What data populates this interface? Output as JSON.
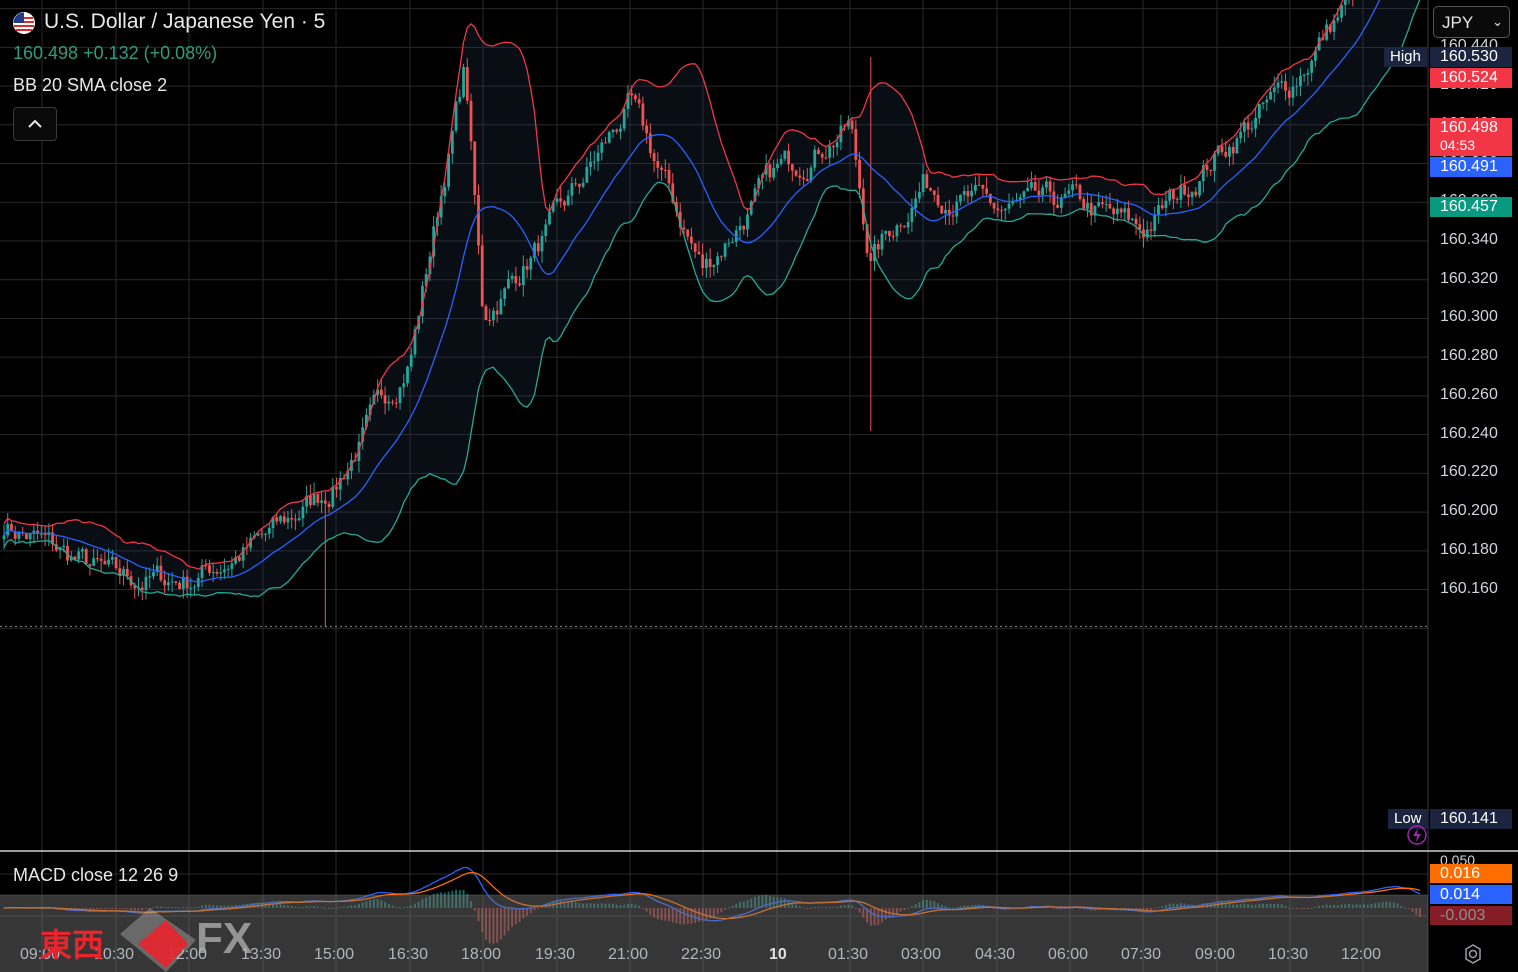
{
  "header": {
    "symbol_title": "U.S. Dollar / Japanese Yen · 5",
    "price_change": "160.498  +0.132 (+0.08%)",
    "indicator_label": "BB 20 SMA close 2",
    "currency": "JPY"
  },
  "macd": {
    "label": "MACD close 12 26 9"
  },
  "price_axis": {
    "labels": [
      "160.440",
      "160.420",
      "160.400",
      "160.380",
      "160.360",
      "160.340",
      "160.320",
      "160.300",
      "160.280",
      "160.260",
      "160.240",
      "160.220",
      "160.200",
      "160.180",
      "160.160"
    ],
    "range": [
      160.13,
      160.54
    ]
  },
  "tags": {
    "high_label": "High",
    "high_value": "160.530",
    "bb_upper": "160.524",
    "last_price": "160.498",
    "countdown": "04:53",
    "bb_basis": "160.491",
    "bb_lower": "160.457",
    "low_label": "Low",
    "low_value": "160.141",
    "macd_top": "0.050",
    "macd_signal": "0.016",
    "macd_line": "0.014",
    "macd_hist": "-0.003"
  },
  "time_axis": [
    "09:00",
    "10:30",
    "12:00",
    "13:30",
    "15:00",
    "16:30",
    "18:00",
    "19:30",
    "21:00",
    "22:30",
    "10",
    "01:30",
    "03:00",
    "04:30",
    "06:00",
    "07:30",
    "09:00",
    "10:30",
    "12:00"
  ],
  "colors": {
    "up": "#26a69a",
    "down": "#ef5350",
    "bb_upper": "#f23645",
    "bb_basis": "#2962ff",
    "bb_lower": "#22ab94",
    "macd": "#2962ff",
    "signal": "#ff6d00"
  },
  "watermark": {
    "text": "東西",
    "fx": "FX"
  },
  "chart_data": {
    "type": "candlestick",
    "x_range": [
      "09:00",
      "12:55"
    ],
    "y_range": [
      160.13,
      160.54
    ],
    "anchors": [
      {
        "time": "09:00",
        "price": 160.195
      },
      {
        "time": "10:30",
        "price": 160.165
      },
      {
        "time": "12:00",
        "price": 160.165
      },
      {
        "time": "13:30",
        "price": 160.185
      },
      {
        "time": "15:00",
        "price": 160.215
      },
      {
        "time": "16:30",
        "price": 160.28
      },
      {
        "time": "17:30",
        "price": 160.43
      },
      {
        "time": "18:00",
        "price": 160.3
      },
      {
        "time": "19:30",
        "price": 160.35
      },
      {
        "time": "21:00",
        "price": 160.41
      },
      {
        "time": "22:30",
        "price": 160.325
      },
      {
        "time": "00:00",
        "price": 160.375
      },
      {
        "time": "01:30",
        "price": 160.4
      },
      {
        "time": "02:00",
        "price": 160.33
      },
      {
        "time": "03:00",
        "price": 160.37
      },
      {
        "time": "04:30",
        "price": 160.355
      },
      {
        "time": "06:00",
        "price": 160.36
      },
      {
        "time": "07:30",
        "price": 160.345
      },
      {
        "time": "09:00",
        "price": 160.385
      },
      {
        "time": "10:30",
        "price": 160.42
      },
      {
        "time": "12:00",
        "price": 160.475
      },
      {
        "time": "12:30",
        "price": 160.52
      },
      {
        "time": "12:55",
        "price": 160.498
      }
    ],
    "high": 160.53,
    "low": 160.141
  }
}
